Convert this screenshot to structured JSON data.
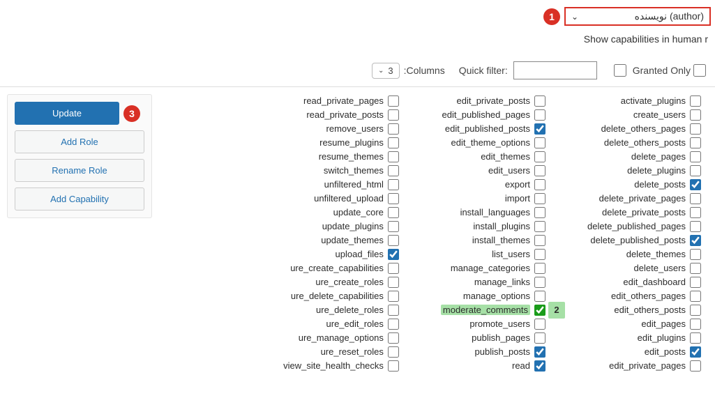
{
  "role_selector": {
    "label": "نویسنده (author)"
  },
  "markers": {
    "one": "1",
    "two": "2",
    "three": "3"
  },
  "human_readable_text": "Show capabilities in human r",
  "toolbar": {
    "columns_label": ":Columns",
    "columns_value": "3",
    "quick_filter_label": "Quick filter:",
    "quick_filter_value": "",
    "granted_only_label": "Granted Only"
  },
  "sidepanel": {
    "update": "Update",
    "add_role": "Add Role",
    "rename_role": "Rename Role",
    "add_capability": "Add Capability"
  },
  "capabilities": {
    "col1": [
      {
        "label": "read_private_pages",
        "checked": false
      },
      {
        "label": "read_private_posts",
        "checked": false
      },
      {
        "label": "remove_users",
        "checked": false
      },
      {
        "label": "resume_plugins",
        "checked": false
      },
      {
        "label": "resume_themes",
        "checked": false
      },
      {
        "label": "switch_themes",
        "checked": false
      },
      {
        "label": "unfiltered_html",
        "checked": false
      },
      {
        "label": "unfiltered_upload",
        "checked": false
      },
      {
        "label": "update_core",
        "checked": false
      },
      {
        "label": "update_plugins",
        "checked": false
      },
      {
        "label": "update_themes",
        "checked": false
      },
      {
        "label": "upload_files",
        "checked": true
      },
      {
        "label": "ure_create_capabilities",
        "checked": false
      },
      {
        "label": "ure_create_roles",
        "checked": false
      },
      {
        "label": "ure_delete_capabilities",
        "checked": false
      },
      {
        "label": "ure_delete_roles",
        "checked": false
      },
      {
        "label": "ure_edit_roles",
        "checked": false
      },
      {
        "label": "ure_manage_options",
        "checked": false
      },
      {
        "label": "ure_reset_roles",
        "checked": false
      },
      {
        "label": "view_site_health_checks",
        "checked": false
      }
    ],
    "col2": [
      {
        "label": "edit_private_posts",
        "checked": false
      },
      {
        "label": "edit_published_pages",
        "checked": false
      },
      {
        "label": "edit_published_posts",
        "checked": true
      },
      {
        "label": "edit_theme_options",
        "checked": false
      },
      {
        "label": "edit_themes",
        "checked": false
      },
      {
        "label": "edit_users",
        "checked": false
      },
      {
        "label": "export",
        "checked": false
      },
      {
        "label": "import",
        "checked": false
      },
      {
        "label": "install_languages",
        "checked": false
      },
      {
        "label": "install_plugins",
        "checked": false
      },
      {
        "label": "install_themes",
        "checked": false
      },
      {
        "label": "list_users",
        "checked": false
      },
      {
        "label": "manage_categories",
        "checked": false
      },
      {
        "label": "manage_links",
        "checked": false
      },
      {
        "label": "manage_options",
        "checked": false
      },
      {
        "label": "moderate_comments",
        "checked": true,
        "highlight": true,
        "marker": "two"
      },
      {
        "label": "promote_users",
        "checked": false
      },
      {
        "label": "publish_pages",
        "checked": false
      },
      {
        "label": "publish_posts",
        "checked": true
      },
      {
        "label": "read",
        "checked": true
      }
    ],
    "col3": [
      {
        "label": "activate_plugins",
        "checked": false
      },
      {
        "label": "create_users",
        "checked": false
      },
      {
        "label": "delete_others_pages",
        "checked": false
      },
      {
        "label": "delete_others_posts",
        "checked": false
      },
      {
        "label": "delete_pages",
        "checked": false
      },
      {
        "label": "delete_plugins",
        "checked": false
      },
      {
        "label": "delete_posts",
        "checked": true
      },
      {
        "label": "delete_private_pages",
        "checked": false
      },
      {
        "label": "delete_private_posts",
        "checked": false
      },
      {
        "label": "delete_published_pages",
        "checked": false
      },
      {
        "label": "delete_published_posts",
        "checked": true
      },
      {
        "label": "delete_themes",
        "checked": false
      },
      {
        "label": "delete_users",
        "checked": false
      },
      {
        "label": "edit_dashboard",
        "checked": false
      },
      {
        "label": "edit_others_pages",
        "checked": false
      },
      {
        "label": "edit_others_posts",
        "checked": false
      },
      {
        "label": "edit_pages",
        "checked": false
      },
      {
        "label": "edit_plugins",
        "checked": false
      },
      {
        "label": "edit_posts",
        "checked": true
      },
      {
        "label": "edit_private_pages",
        "checked": false
      }
    ]
  }
}
